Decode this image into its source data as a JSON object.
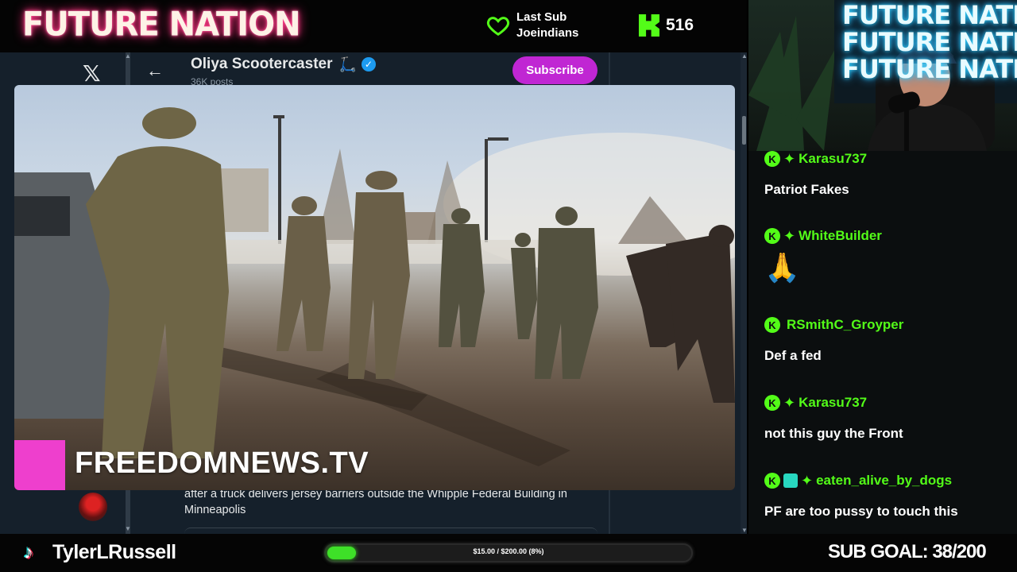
{
  "banner": {
    "logo": "FUTURE NATION",
    "last_sub_label": "Last Sub",
    "last_sub_name": "Joeindians",
    "kick_logo": "K",
    "kick_count": "516"
  },
  "browser": {
    "x_logo": "𝕏",
    "back_arrow": "←",
    "profile_name": "Oliya Scootercaster",
    "profile_emoji": "🛴",
    "verified_mark": "✓",
    "post_count": "36K posts",
    "subscribe_label": "Subscribe",
    "post_caption": "after a truck delivers jersey barriers outside the Whipple Federal Building in Minneapolis",
    "video_watermark": "FREEDOMNEWS.TV",
    "watermark_color": "#ee3fcd",
    "subscribe_color": "#c026d3"
  },
  "webcam": {
    "sign_lines": [
      "FUTURE NATION",
      "FUTURE NATION",
      "FUTURE NATION"
    ]
  },
  "chat": {
    "kick_badge": "K",
    "messages": [
      {
        "user": "Karasu737",
        "text": "Patriot Fakes"
      },
      {
        "user": "WhiteBuilder",
        "emote": "🙏"
      },
      {
        "user": "RSmithC_Groyper",
        "text": "Def a fed"
      },
      {
        "user": "Karasu737",
        "text": "not this guy the Front"
      },
      {
        "user": "eaten_alive_by_dogs",
        "text": "PF are too pussy to touch this"
      }
    ],
    "username_color": "#53fc18"
  },
  "footer": {
    "tiktok_icon": "♪",
    "tiktok_name": "TylerLRussell",
    "goal_text": "$15.00 / $200.00 (8%)",
    "goal_progress": 0.08,
    "sub_goal": "SUB GOAL: 38/200",
    "progress_color": "#3ee028"
  }
}
